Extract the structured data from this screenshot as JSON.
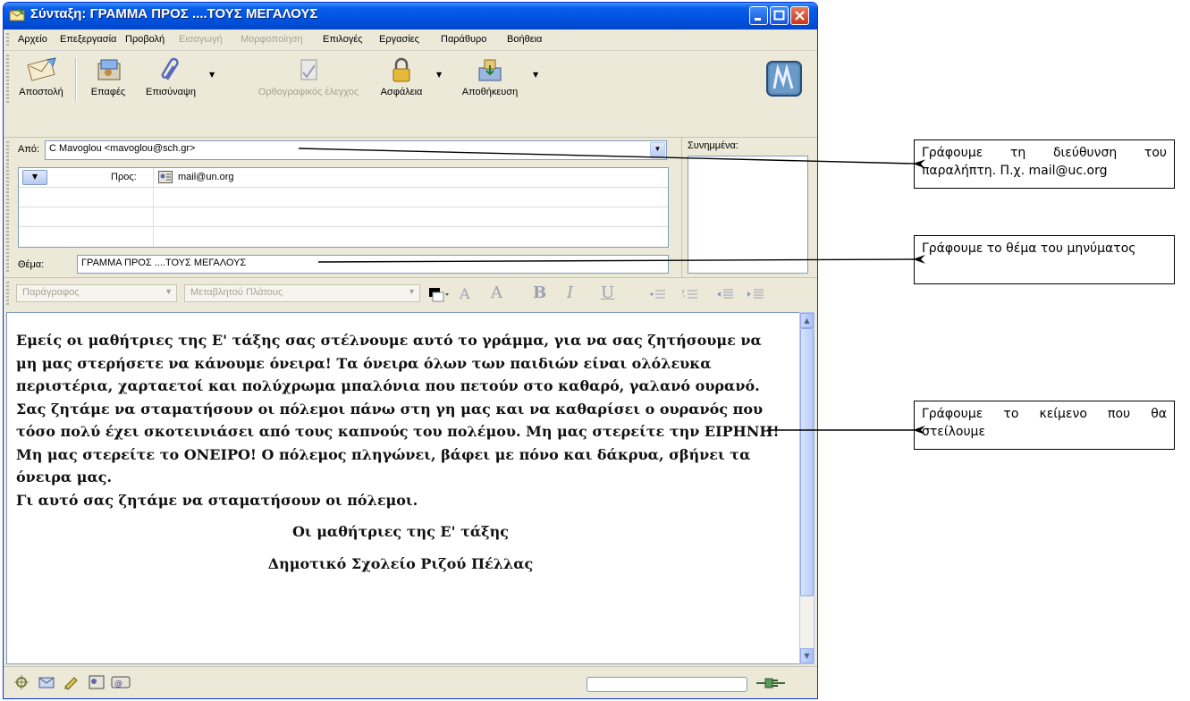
{
  "window": {
    "title": "Σύνταξη: ΓΡΑΜΜΑ ΠΡΟΣ ....ΤΟΥΣ ΜΕΓΑΛΟΥΣ"
  },
  "menu": [
    {
      "label": "Αρχείο",
      "enabled": true
    },
    {
      "label": "Επεξεργασία",
      "enabled": true
    },
    {
      "label": "Προβολή",
      "enabled": true
    },
    {
      "label": "Εισαγωγή",
      "enabled": false
    },
    {
      "label": "Μορφοποίηση",
      "enabled": false
    },
    {
      "label": "Επιλογές",
      "enabled": true
    },
    {
      "label": "Εργασίες",
      "enabled": true
    },
    {
      "label": "Παράθυρο",
      "enabled": true
    },
    {
      "label": "Βοήθεια",
      "enabled": true
    }
  ],
  "toolbar": {
    "send": "Αποστολή",
    "contacts": "Επαφές",
    "attach": "Επισύναψη",
    "spell": "Ορθογραφικός έλεγχος",
    "security": "Ασφάλεια",
    "save": "Αποθήκευση"
  },
  "compose": {
    "from_label": "Από:",
    "from_value": "C Mavoglou <mavoglou@sch.gr>",
    "to_label": "Προς:",
    "to_value": "mail@un.org",
    "subject_label": "Θέμα:",
    "subject_value": "ΓΡΑΜΜΑ ΠΡΟΣ ....ΤΟΥΣ ΜΕΓΑΛΟΥΣ",
    "attachments_label": "Συνημμένα:"
  },
  "format": {
    "paragraph": "Παράγραφος",
    "font": "Μεταβλητού Πλάτους"
  },
  "body": {
    "paragraph1": "Εμείς οι μαθήτριες της Ε' τάξης σας στέλνουμε αυτό το γράμμα, για να σας ζητήσουμε να μη μας στερήσετε να κάνουμε όνειρα! Τα όνειρα όλων των παιδιών είναι ολόλευκα περιστέρια, χαρταετοί και πολύχρωμα μπαλόνια που πετούν στο καθαρό, γαλανό ουρανό. Σας ζητάμε να σταματήσουν οι πόλεμοι πάνω στη γη μας και να καθαρίσει ο ουρανός που τόσο πολύ έχει σκοτεινιάσει από τους καπνούς του πολέμου. Μη μας στερείτε την ΕΙΡΗΝΗ! Μη μας στερείτε το ΟΝΕΙΡΟ! Ο πόλεμος πληγώνει, βάφει με πόνο και δάκρυα, σβήνει τα όνειρα μας.",
    "paragraph2": "Γι αυτό σας ζητάμε να σταματήσουν οι πόλεμοι.",
    "signature1": "Οι μαθήτριες της Ε' τάξης",
    "signature2": "Δημοτικό Σχολείο Ριζού Πέλλας"
  },
  "callouts": {
    "recipient": "Γράφουμε τη διεύθυνση του παραλήπτη. Π.χ. mail@uc.org",
    "subject": "Γράφουμε το θέμα του μηνύματος",
    "body": "Γράφουμε το κείμενο που θα στείλουμε"
  }
}
